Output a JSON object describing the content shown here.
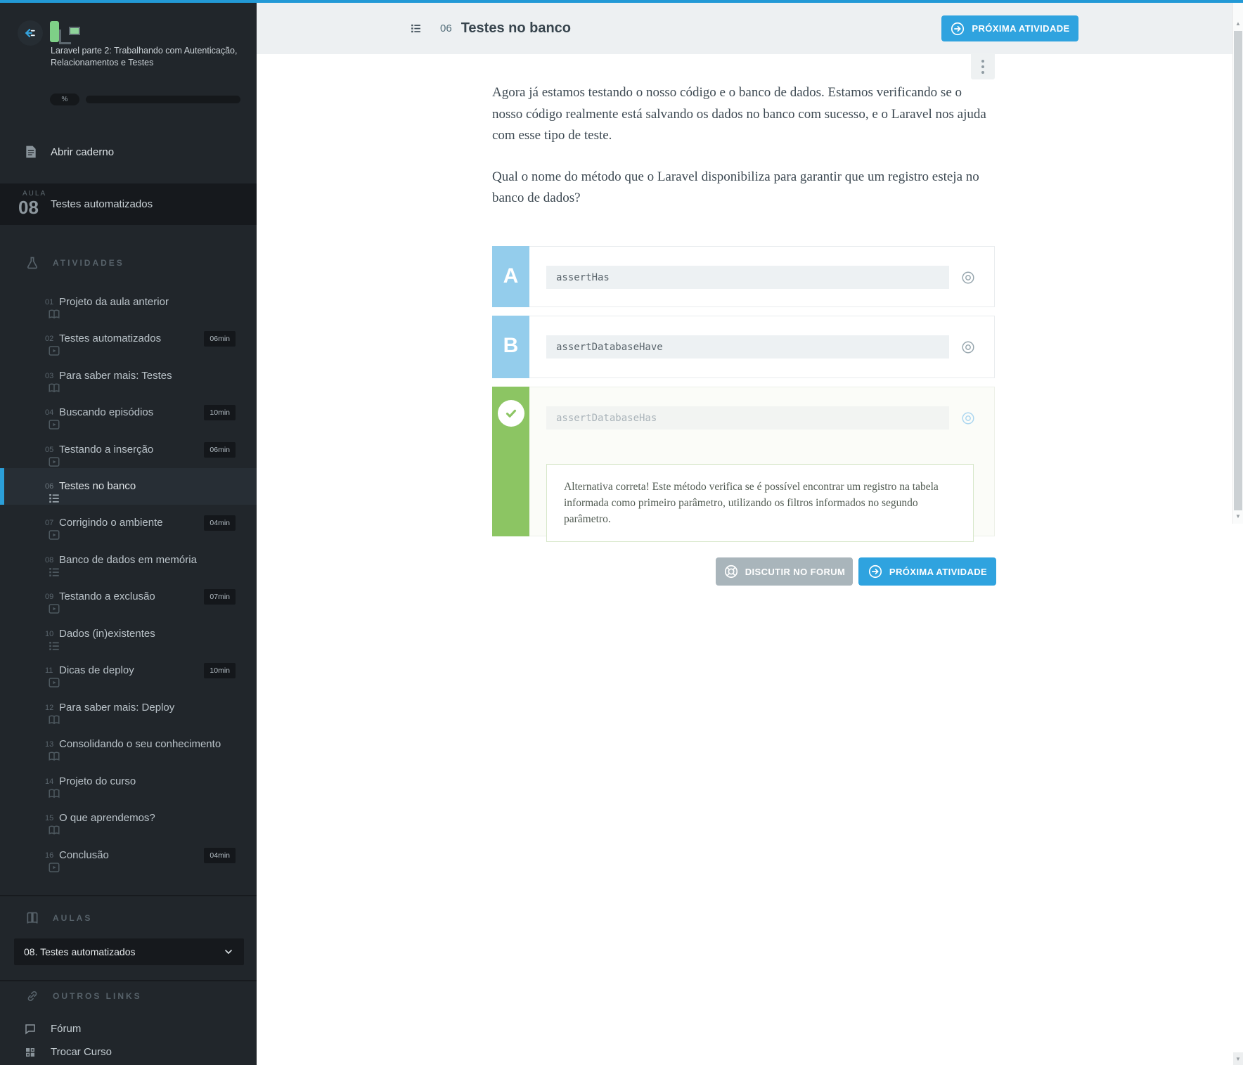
{
  "colors": {
    "accent_blue": "#2fa3df",
    "letter_blue": "#94cdec",
    "success_green": "#8cc563",
    "sidebar_bg": "#21262b"
  },
  "sidebar": {
    "course_title": "Laravel parte 2: Trabalhando com Autenticação, Relacionamentos e Testes",
    "progress_label": "%",
    "notebook_label": "Abrir caderno",
    "lesson": {
      "kicker": "AULA",
      "number": "08",
      "title": "Testes automatizados"
    },
    "activities_header": "ATIVIDADES",
    "activities": [
      {
        "num": "01",
        "type": "book",
        "label": "Projeto da aula anterior",
        "duration": "",
        "active": false
      },
      {
        "num": "02",
        "type": "video",
        "label": "Testes automatizados",
        "duration": "06min",
        "active": false
      },
      {
        "num": "03",
        "type": "book",
        "label": "Para saber mais: Testes",
        "duration": "",
        "active": false
      },
      {
        "num": "04",
        "type": "video",
        "label": "Buscando episódios",
        "duration": "10min",
        "active": false
      },
      {
        "num": "05",
        "type": "video",
        "label": "Testando a inserção",
        "duration": "06min",
        "active": false
      },
      {
        "num": "06",
        "type": "quiz",
        "label": "Testes no banco",
        "duration": "",
        "active": true
      },
      {
        "num": "07",
        "type": "video",
        "label": "Corrigindo o ambiente",
        "duration": "04min",
        "active": false
      },
      {
        "num": "08",
        "type": "quiz",
        "label": "Banco de dados em memória",
        "duration": "",
        "active": false
      },
      {
        "num": "09",
        "type": "video",
        "label": "Testando a exclusão",
        "duration": "07min",
        "active": false
      },
      {
        "num": "10",
        "type": "quiz",
        "label": "Dados (in)existentes",
        "duration": "",
        "active": false
      },
      {
        "num": "11",
        "type": "video",
        "label": "Dicas de deploy",
        "duration": "10min",
        "active": false
      },
      {
        "num": "12",
        "type": "book",
        "label": "Para saber mais: Deploy",
        "duration": "",
        "active": false
      },
      {
        "num": "13",
        "type": "book",
        "label": "Consolidando o seu conhecimento",
        "duration": "",
        "active": false
      },
      {
        "num": "14",
        "type": "book",
        "label": "Projeto do curso",
        "duration": "",
        "active": false
      },
      {
        "num": "15",
        "type": "book",
        "label": "O que aprendemos?",
        "duration": "",
        "active": false
      },
      {
        "num": "16",
        "type": "video",
        "label": "Conclusão",
        "duration": "04min",
        "active": false
      }
    ],
    "aulas_header": "AULAS",
    "aulas_dropdown": "08. Testes automatizados",
    "other_links_header": "OUTROS LINKS",
    "links": [
      {
        "label": "Fórum",
        "icon": "chat"
      },
      {
        "label": "Trocar Curso",
        "icon": "grid"
      }
    ]
  },
  "header": {
    "number": "06",
    "title": "Testes no banco",
    "next_button": "PRÓXIMA ATIVIDADE"
  },
  "question": {
    "p1": "Agora já estamos testando o nosso código e o banco de dados. Estamos verificando se o nosso código realmente está salvando os dados no banco com sucesso, e o Laravel nos ajuda com esse tipo de teste.",
    "p2": "Qual o nome do método que o Laravel disponibiliza para garantir que um registro esteja no banco de dados?"
  },
  "options": [
    {
      "letter": "A",
      "value": "assertHas",
      "correct": false
    },
    {
      "letter": "B",
      "value": "assertDatabaseHave",
      "correct": false
    },
    {
      "letter": "",
      "value": "assertDatabaseHas",
      "correct": true,
      "feedback": "Alternativa correta! Este método verifica se é possível encontrar um registro na tabela informada como primeiro parâmetro, utilizando os filtros informados no segundo parâmetro."
    }
  ],
  "footer": {
    "forum_button": "DISCUTIR NO FORUM",
    "next_button": "PRÓXIMA ATIVIDADE"
  }
}
